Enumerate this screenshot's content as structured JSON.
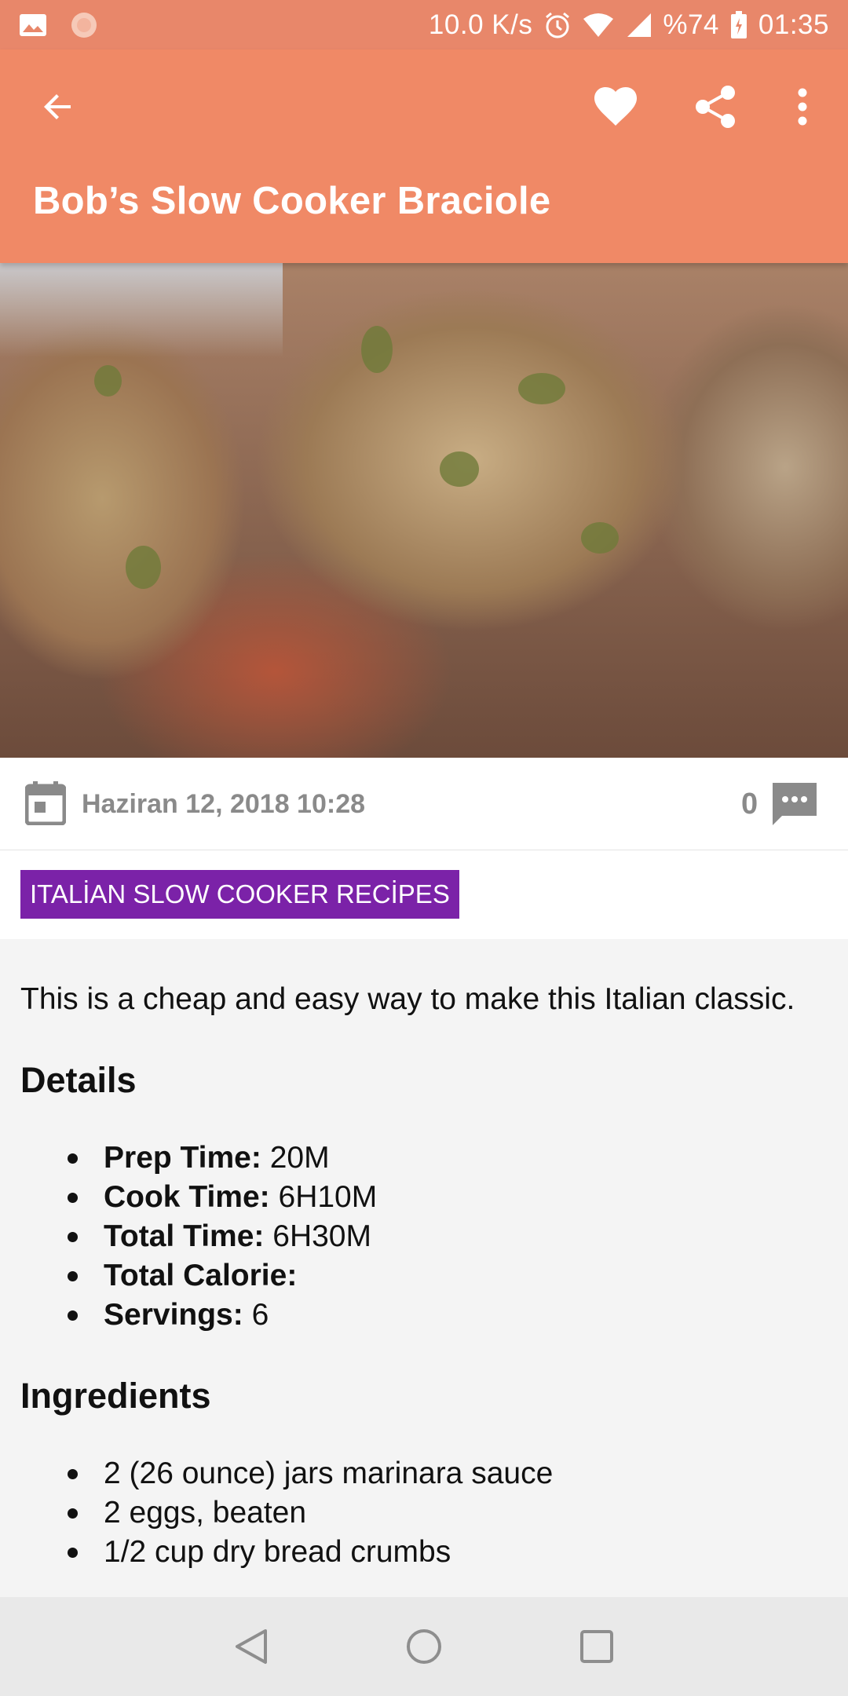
{
  "status_bar": {
    "network_speed": "10.0 K/s",
    "battery": "%74",
    "time": "01:35"
  },
  "app_bar": {
    "title": "Bob’s Slow Cooker Braciole"
  },
  "meta": {
    "date": "Haziran 12, 2018 10:28",
    "comment_count": "0"
  },
  "category": {
    "label": "ITALİAN SLOW COOKER RECİPES"
  },
  "content": {
    "intro": "This is a cheap and easy way to make this Italian classic.",
    "details_heading": "Details",
    "details": [
      {
        "label": "Prep Time:",
        "value": "20M"
      },
      {
        "label": "Cook Time:",
        "value": "6H10M"
      },
      {
        "label": "Total Time:",
        "value": "6H30M"
      },
      {
        "label": "Total Calorie:",
        "value": ""
      },
      {
        "label": "Servings:",
        "value": "6"
      }
    ],
    "ingredients_heading": "Ingredients",
    "ingredients": [
      "2 (26 ounce) jars marinara sauce",
      "2 eggs, beaten",
      "1/2 cup dry bread crumbs"
    ]
  },
  "colors": {
    "app_bar": "#f08966",
    "status_bar": "#e8876a",
    "category_chip": "#7b22a8"
  }
}
